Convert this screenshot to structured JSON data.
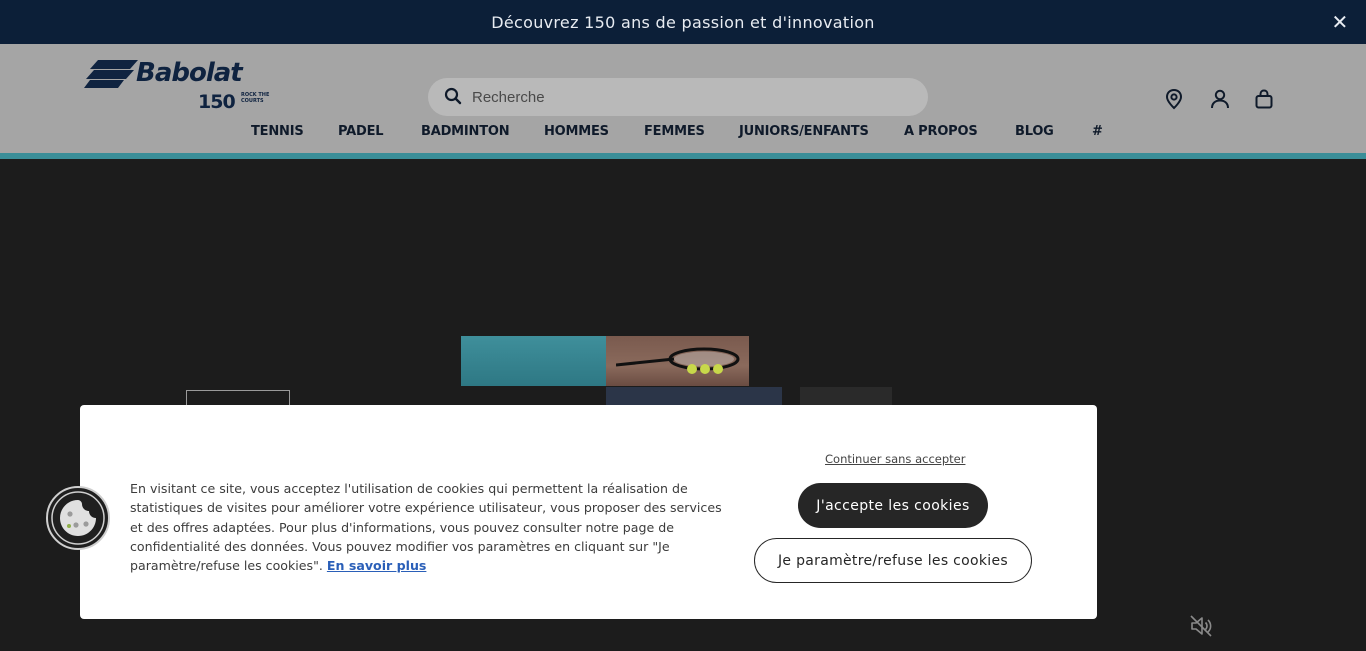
{
  "promo": {
    "text": "Découvrez 150 ans de passion et d'innovation",
    "close": "✕"
  },
  "brand": {
    "name": "Babolat",
    "anniversary": "150",
    "tagline": "ROCK THE COURTS"
  },
  "search": {
    "placeholder": "Recherche"
  },
  "header_icons": [
    "location-pin-icon",
    "account-icon",
    "shopping-bag-icon"
  ],
  "nav": {
    "items": [
      {
        "label": "TENNIS"
      },
      {
        "label": "PADEL"
      },
      {
        "label": "BADMINTON"
      },
      {
        "label": "HOMMES"
      },
      {
        "label": "FEMMES"
      },
      {
        "label": "JUNIORS/ENFANTS"
      },
      {
        "label": "A PROPOS"
      },
      {
        "label": "BLOG"
      },
      {
        "label": "#"
      }
    ]
  },
  "cookie": {
    "text": "En visitant ce site, vous acceptez l'utilisation de cookies qui permettent la réalisation de statistiques de visites pour améliorer votre expérience utilisateur, vous proposer des services et des offres adaptées. Pour plus d'informations, vous pouvez consulter notre page de confidentialité des données. Vous pouvez modifier vos paramètres en cliquant sur \"Je paramètre/refuse les cookies\".",
    "learn_more": "En savoir plus",
    "continue": "Continuer sans accepter",
    "accept": "J'accepte les cookies",
    "refuse": "Je paramètre/refuse les cookies"
  },
  "colors": {
    "promo_bg": "#0c1f38",
    "brand_navy": "#0f2340",
    "accent_teal": "#3a8e98",
    "button_dark": "#262626"
  }
}
